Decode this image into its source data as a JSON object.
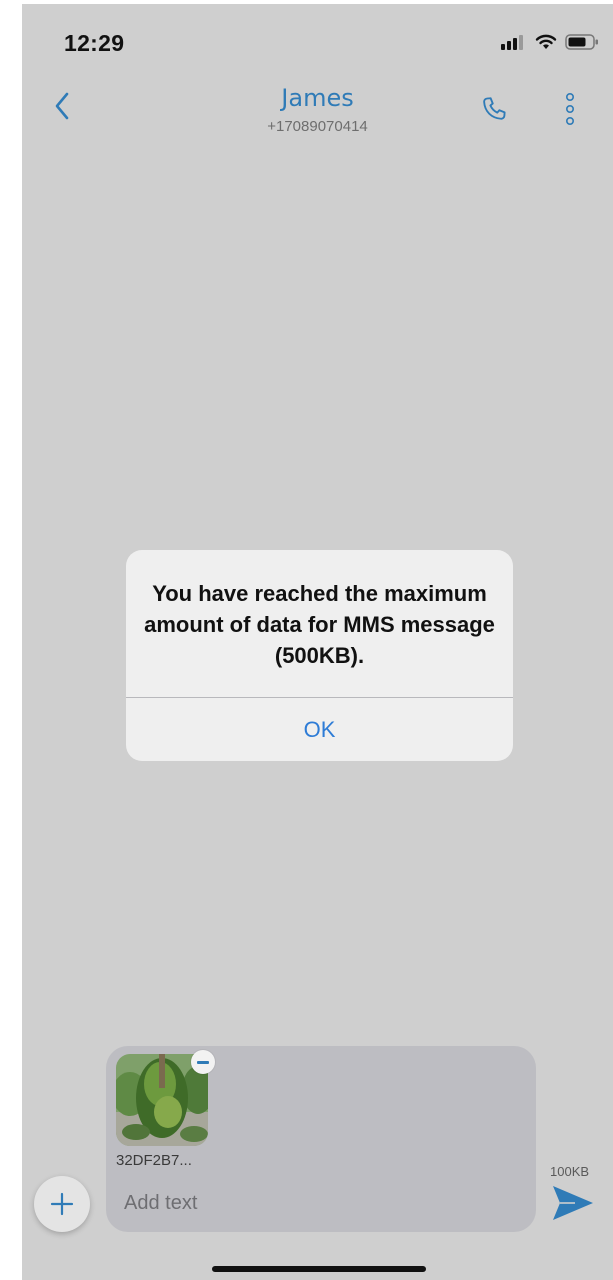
{
  "status_bar": {
    "time": "12:29"
  },
  "header": {
    "back_icon": "chevron-left-icon",
    "contact_name": "James",
    "contact_phone": "+17089070414",
    "call_icon": "phone-icon",
    "more_icon": "more-vertical-icon"
  },
  "alert": {
    "message": "You have reached the maximum amount of data for MMS message (500KB).",
    "ok_label": "OK"
  },
  "composer": {
    "attachment_name": "32DF2B7...",
    "remove_icon": "minus-icon",
    "add_icon": "plus-icon",
    "input_placeholder": "Add text",
    "input_value": "",
    "size_label": "100KB",
    "send_icon": "send-icon"
  },
  "colors": {
    "accent": "#2f7bb7",
    "alert_action": "#2e7cd6",
    "screen_background": "#cfcfcf"
  }
}
